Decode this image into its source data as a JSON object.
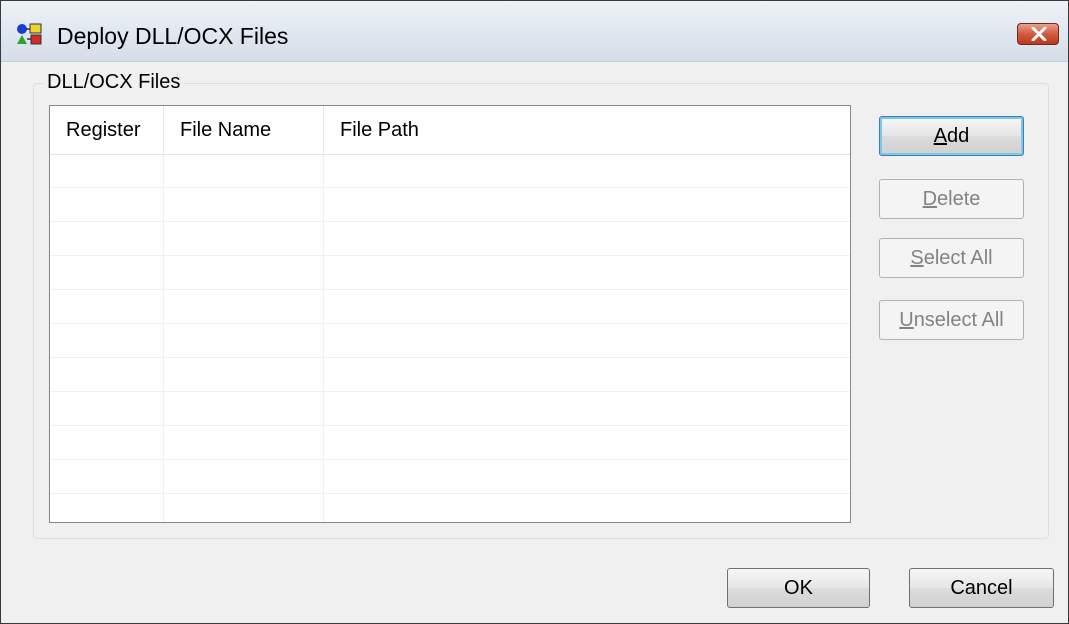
{
  "window": {
    "title": "Deploy DLL/OCX Files",
    "close_label": "✕"
  },
  "group": {
    "label": "DLL/OCX Files"
  },
  "table": {
    "columns": [
      "Register",
      "File Name",
      "File Path"
    ],
    "rows": []
  },
  "side_buttons": {
    "add": {
      "mnemonic": "A",
      "rest": "dd",
      "enabled": true
    },
    "delete": {
      "mnemonic": "D",
      "rest": "elete",
      "enabled": false
    },
    "select_all": {
      "mnemonic": "S",
      "rest": "elect All",
      "enabled": false
    },
    "unselect_all": {
      "mnemonic": "U",
      "rest": "nselect All",
      "enabled": false
    }
  },
  "footer": {
    "ok_label": "OK",
    "cancel_label": "Cancel"
  },
  "colors": {
    "titlebar": "#dfe6ef",
    "close_button": "#d35a3e",
    "default_button_border": "#3c7fb1"
  }
}
